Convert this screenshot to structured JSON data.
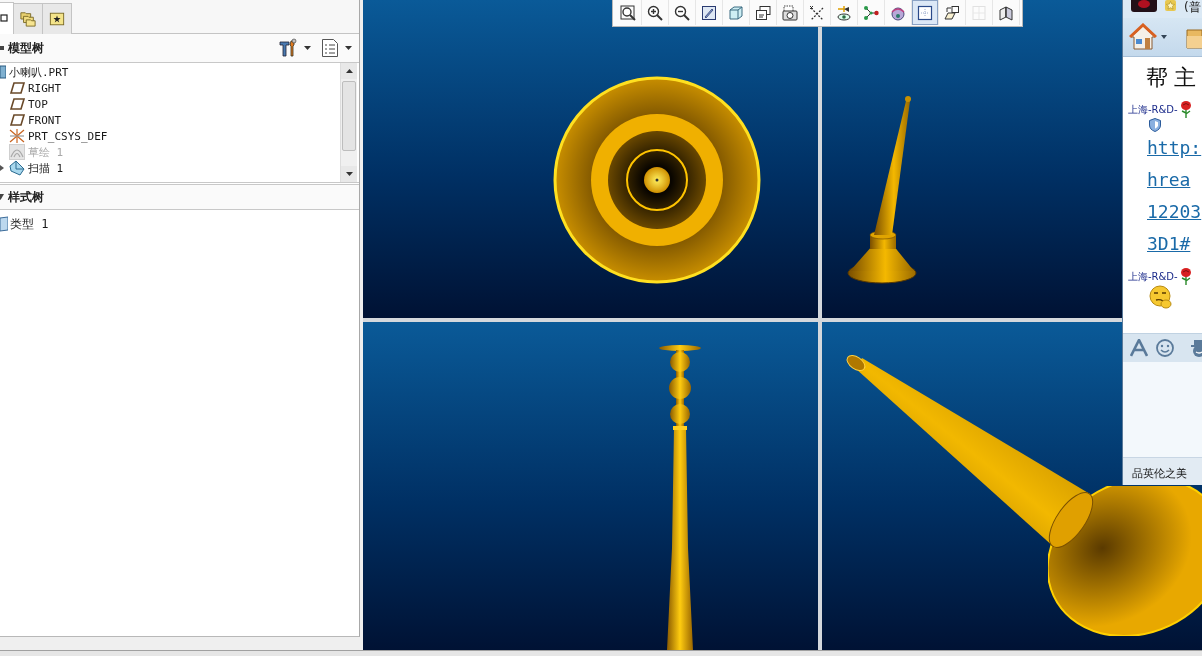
{
  "navigator": {
    "tabs": [
      {
        "kind": "tree",
        "selected": true
      },
      {
        "kind": "folders",
        "selected": false
      },
      {
        "kind": "favorites",
        "selected": false
      }
    ]
  },
  "model_tree": {
    "title": "模型树",
    "items": [
      {
        "label": "小喇叭.PRT",
        "kind": "part",
        "disabled": false,
        "children": [
          {
            "label": "RIGHT",
            "kind": "plane",
            "disabled": false,
            "collapsed": false
          },
          {
            "label": "TOP",
            "kind": "plane",
            "disabled": false,
            "collapsed": false
          },
          {
            "label": "FRONT",
            "kind": "plane",
            "disabled": false,
            "collapsed": false
          },
          {
            "label": "PRT_CSYS_DEF",
            "kind": "csys",
            "disabled": false,
            "collapsed": false
          },
          {
            "label": "草绘 1",
            "kind": "sketch",
            "disabled": true,
            "collapsed": false
          },
          {
            "label": "扫描 1",
            "kind": "sweep",
            "disabled": false,
            "collapsed": true
          }
        ]
      }
    ]
  },
  "style_tree": {
    "title": "样式树",
    "items": [
      {
        "label": "类型 1",
        "kind": "style"
      }
    ]
  },
  "view_toolbar": {
    "buttons": [
      {
        "kind": "refit",
        "selected": false,
        "disabled": false
      },
      {
        "kind": "zoomin",
        "selected": false,
        "disabled": false
      },
      {
        "kind": "zoomout",
        "selected": false,
        "disabled": false
      },
      {
        "kind": "repaint",
        "selected": false,
        "disabled": false
      },
      {
        "kind": "cube",
        "selected": false,
        "disabled": false
      },
      {
        "kind": "views",
        "selected": false,
        "disabled": false
      },
      {
        "kind": "camera",
        "selected": false,
        "disabled": false
      },
      {
        "kind": "axes",
        "selected": false,
        "disabled": false
      },
      {
        "kind": "annotations",
        "selected": false,
        "disabled": false
      },
      {
        "kind": "nodes",
        "selected": false,
        "disabled": false
      },
      {
        "kind": "appearance",
        "selected": false,
        "disabled": false
      },
      {
        "kind": "layout",
        "selected": true,
        "disabled": false
      },
      {
        "kind": "orient",
        "selected": false,
        "disabled": false
      },
      {
        "kind": "grid",
        "selected": false,
        "disabled": true
      },
      {
        "kind": "plane",
        "selected": false,
        "disabled": false
      }
    ]
  },
  "viewports": [
    {
      "kind": "front"
    },
    {
      "kind": "iso"
    },
    {
      "kind": "side"
    },
    {
      "kind": "perspective"
    }
  ],
  "chat_window": {
    "status": "(普",
    "banner": "帮主",
    "messages": [
      {
        "kind": "link",
        "sender": "上海-R&D-",
        "lines": [
          "http:",
          "hrea",
          "12203",
          "3D1#"
        ]
      },
      {
        "kind": "emoji",
        "sender": "上海-R&D-"
      }
    ],
    "footer": "品英伦之美"
  }
}
